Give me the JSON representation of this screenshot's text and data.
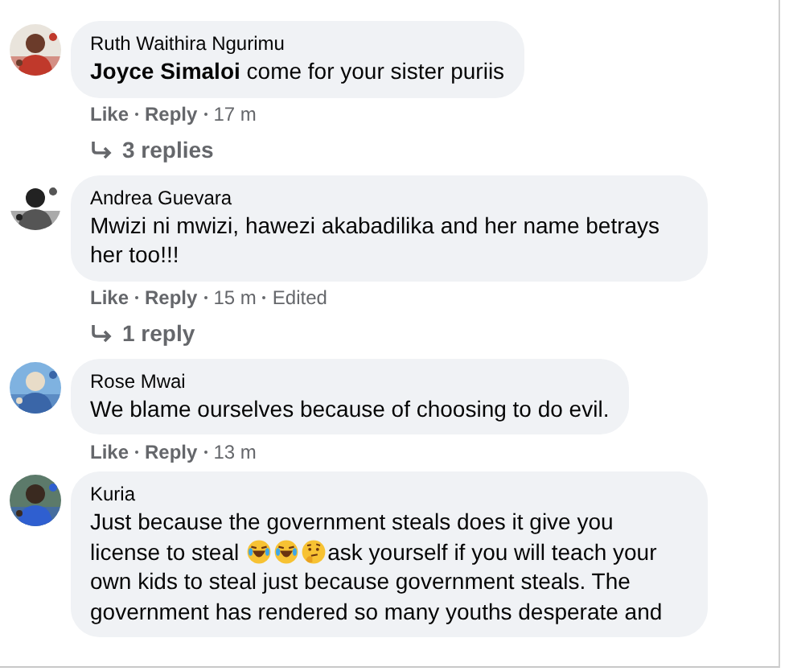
{
  "comments": [
    {
      "author": "Ruth Waithira Ngurimu",
      "lines": [
        [
          {
            "kind": "mention",
            "text": "Joyce Simaloi"
          },
          {
            "kind": "text",
            "text": " come for your sister puriis"
          }
        ]
      ],
      "like": "Like",
      "reply": "Reply",
      "time": "17 m",
      "replies": "3 replies"
    },
    {
      "author": "Andrea Guevara",
      "lines": [
        [
          {
            "kind": "text",
            "text": "Mwizi ni mwizi, hawezi akabadilika and her name betrays her too!!!"
          }
        ]
      ],
      "like": "Like",
      "reply": "Reply",
      "time": "15 m",
      "edited": "Edited",
      "replies": "1 reply"
    },
    {
      "author": "Rose Mwai",
      "lines": [
        [
          {
            "kind": "text",
            "text": "We blame ourselves because of choosing to do evil."
          }
        ]
      ],
      "like": "Like",
      "reply": "Reply",
      "time": "13 m"
    },
    {
      "author": "Kuria",
      "lines": [
        [
          {
            "kind": "text",
            "text": "Just because the government steals does it give you"
          }
        ],
        [
          {
            "kind": "text",
            "text": "license to steal"
          },
          {
            "kind": "laugh-emoji"
          },
          {
            "kind": "laugh-emoji"
          },
          {
            "kind": "thinking-emoji"
          },
          {
            "kind": "text",
            "text": "ask yourself if you will teach your"
          }
        ],
        [
          {
            "kind": "text",
            "text": "own kids to steal just because government steals. The government has rendered so many youths desperate and"
          }
        ]
      ]
    }
  ]
}
